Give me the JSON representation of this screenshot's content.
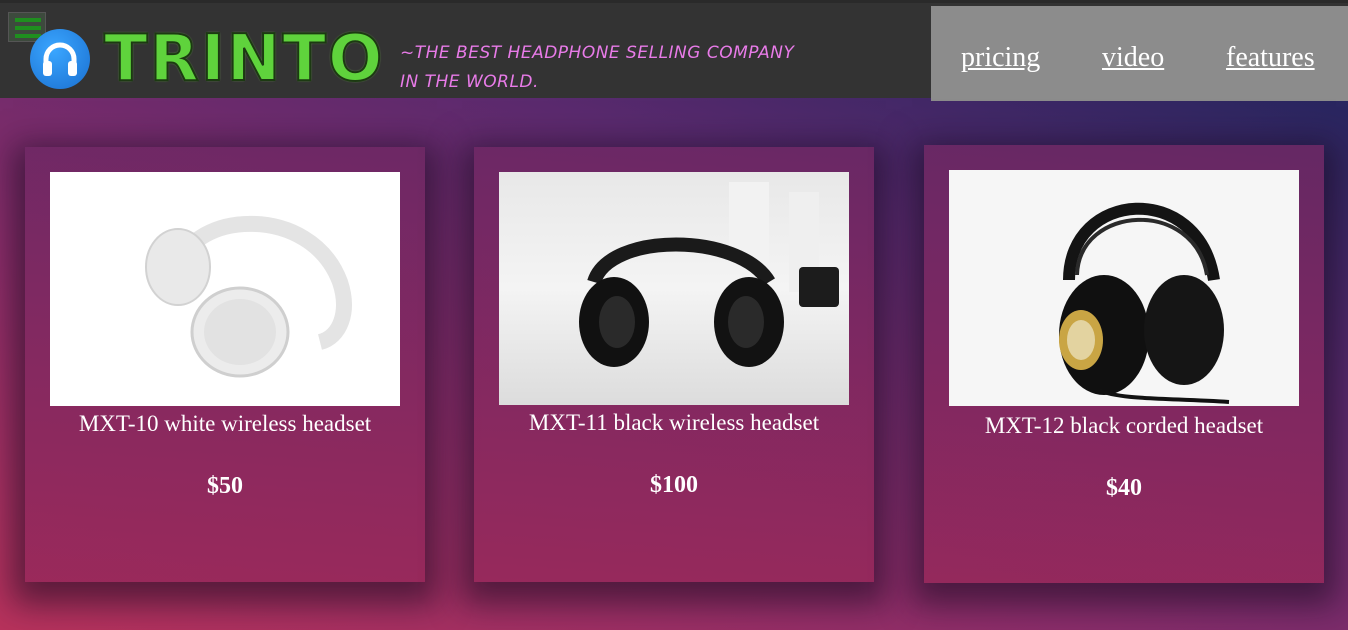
{
  "header": {
    "brand": "TRINTO",
    "tagline_line1": "~THE BEST HEADPHONE SELLING COMPANY",
    "tagline_line2": "IN THE WORLD.",
    "nav": {
      "pricing": "pricing",
      "video": "video",
      "features": "features"
    }
  },
  "products": [
    {
      "name": "MXT-10 white wireless headset",
      "price": "$50",
      "image": "white-wireless-headphones"
    },
    {
      "name": "MXT-11 black wireless headset",
      "price": "$100",
      "image": "black-wireless-headphones"
    },
    {
      "name": "MXT-12 black corded headset",
      "price": "$40",
      "image": "black-corded-headphones"
    }
  ],
  "colors": {
    "header_bg": "#333333",
    "nav_bg": "#8c8c8c",
    "tagline": "#e87be8",
    "brand": "#5fd33c",
    "logo_icon": "#2a8ae8"
  }
}
